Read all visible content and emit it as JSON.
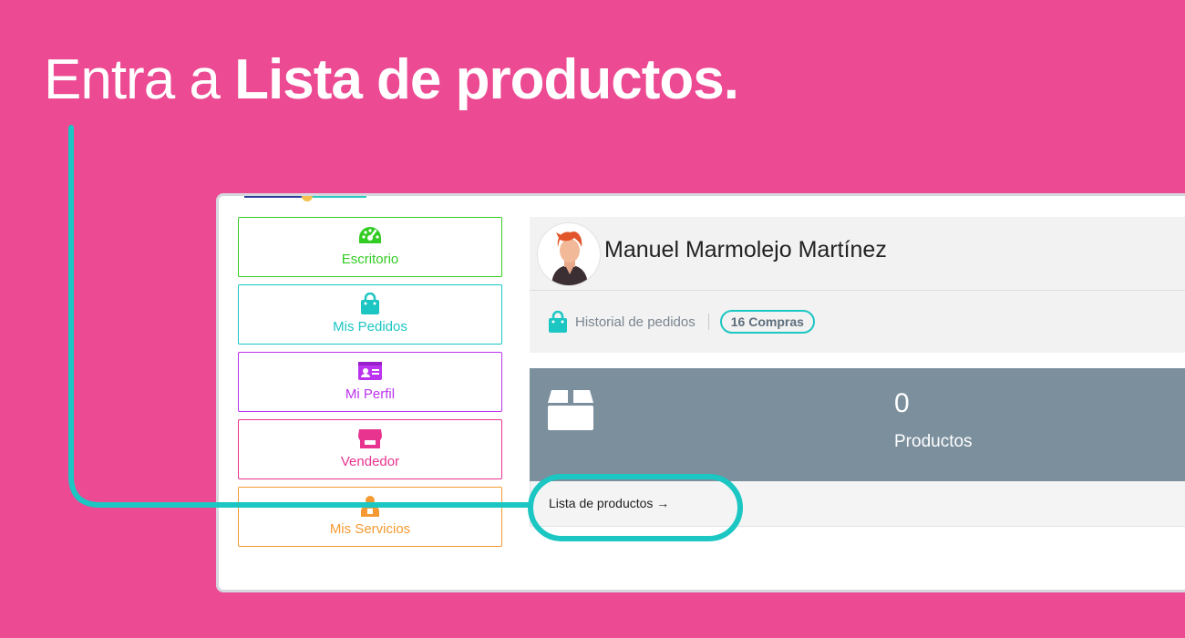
{
  "instruction": {
    "prefix": "Entra a ",
    "bold": "Lista de productos."
  },
  "sidebar": {
    "items": [
      {
        "label": "Escritorio",
        "icon": "dashboard-gauge-icon",
        "color": "#33cc22"
      },
      {
        "label": "Mis Pedidos",
        "icon": "shopping-bag-icon",
        "color": "#1bc6c3"
      },
      {
        "label": "Mi Perfil",
        "icon": "id-card-icon",
        "color": "#bb33ee"
      },
      {
        "label": "Vendedor",
        "icon": "store-icon",
        "color": "#e8338f"
      },
      {
        "label": "Mis Servicios",
        "icon": "worker-icon",
        "color": "#f59a32"
      }
    ]
  },
  "profile": {
    "name": "Manuel Marmolejo Martínez",
    "history_label": "Historial de pedidos",
    "purchases_badge": "16 Compras"
  },
  "products": {
    "count": "0",
    "label": "Productos",
    "link": "Lista de productos"
  },
  "colors": {
    "background": "#ec4b93",
    "highlight": "#1bc6c3",
    "stat_card": "#7b8f9d"
  }
}
